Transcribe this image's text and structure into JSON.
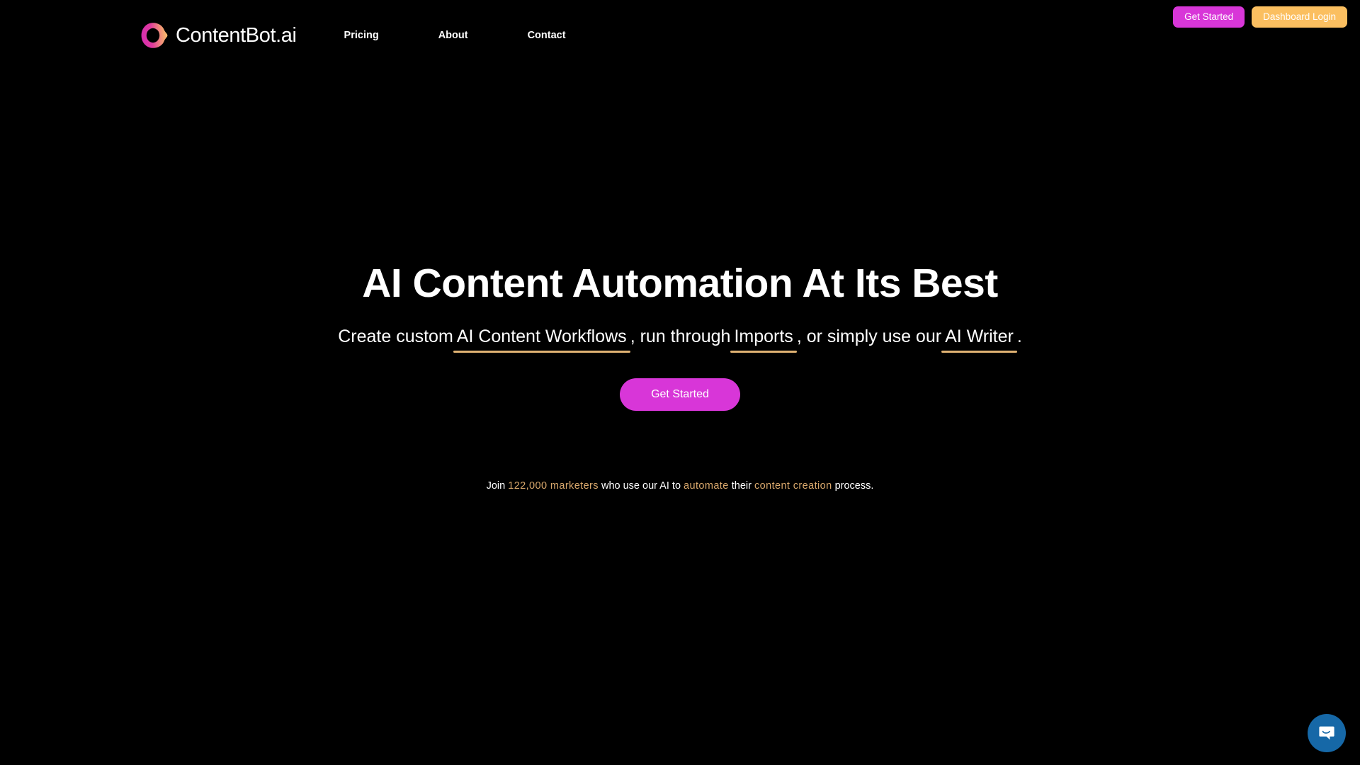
{
  "brand": {
    "name": "ContentBot.ai",
    "logo_icon": "contentbot-ring-logo",
    "logo_gradient_from": "#e0399f",
    "logo_gradient_to": "#f9b668"
  },
  "nav": {
    "items": [
      {
        "label": "Pricing"
      },
      {
        "label": "About"
      },
      {
        "label": "Contact"
      }
    ]
  },
  "top_actions": {
    "get_started": {
      "label": "Get Started",
      "color": "#d836d8"
    },
    "dashboard_login": {
      "label": "Dashboard Login",
      "color": "#fbbf60"
    }
  },
  "hero": {
    "title": "AI Content Automation At Its Best",
    "subtitle": {
      "part1": "Create custom",
      "highlight1": "AI Content Workflows",
      "part2": ", run through",
      "highlight2": "Imports",
      "part3": ", or simply use our",
      "highlight3": "AI Writer",
      "part4": ".",
      "underline_color": "#e0b273"
    },
    "cta": {
      "label": "Get Started",
      "color": "#d836d8"
    },
    "social_proof": {
      "prefix": "Join ",
      "count": "122,000 marketers",
      "mid1": " who use our AI to ",
      "action": "automate",
      "mid2": " their ",
      "topic": "content creation",
      "suffix": " process.",
      "accent_color": "#d9a86c"
    }
  },
  "chat_widget": {
    "icon": "chat-bubble-smile-icon",
    "color": "#1668a7"
  }
}
